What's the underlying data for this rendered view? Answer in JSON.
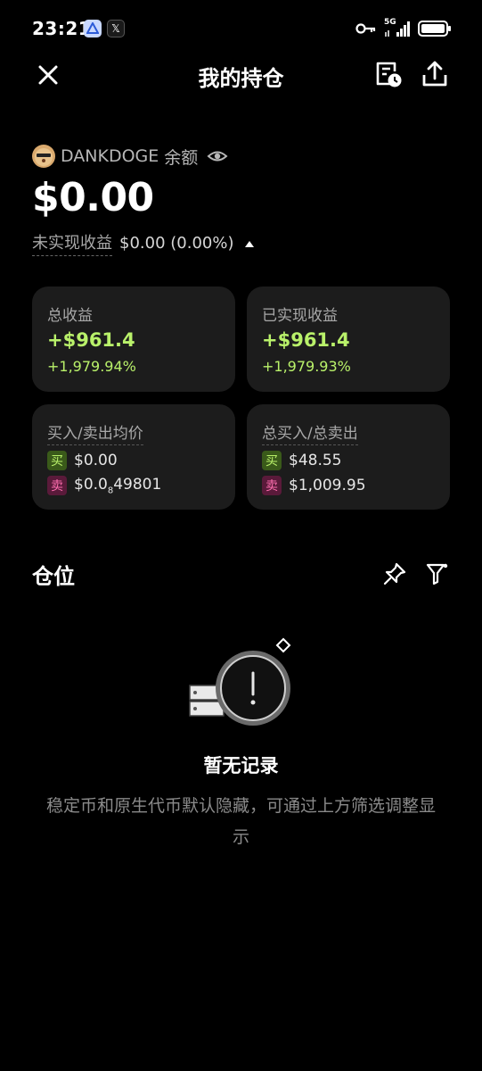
{
  "status_bar": {
    "time": "23:21",
    "network": "5G"
  },
  "header": {
    "title": "我的持仓"
  },
  "wallet": {
    "token_name": "DANKDOGE",
    "balance_label": "余额",
    "balance": "$0.00",
    "unrealized_label": "未实现收益",
    "unrealized_value": "$0.00 (0.00%)"
  },
  "cards": {
    "total_pnl": {
      "title": "总收益",
      "value": "+$961.4",
      "percent": "+1,979.94%"
    },
    "realized_pnl": {
      "title": "已实现收益",
      "value": "+$961.4",
      "percent": "+1,979.93%"
    },
    "avg_price": {
      "title": "买入/卖出均价",
      "buy_tag": "买",
      "buy_value": "$0.00",
      "sell_tag": "卖",
      "sell_prefix": "$0.0",
      "sell_sub": "8",
      "sell_rest": "49801"
    },
    "totals": {
      "title": "总买入/总卖出",
      "buy_tag": "买",
      "buy_value": "$48.55",
      "sell_tag": "卖",
      "sell_value": "$1,009.95"
    }
  },
  "positions": {
    "title": "仓位",
    "empty_title": "暂无记录",
    "empty_desc": "稳定币和原生代币默认隐藏，可通过上方筛选调整显示"
  },
  "colors": {
    "background": "#000000",
    "card": "#1c1c1c",
    "positive": "#b9f16a",
    "sell": "#ff6fb0"
  }
}
